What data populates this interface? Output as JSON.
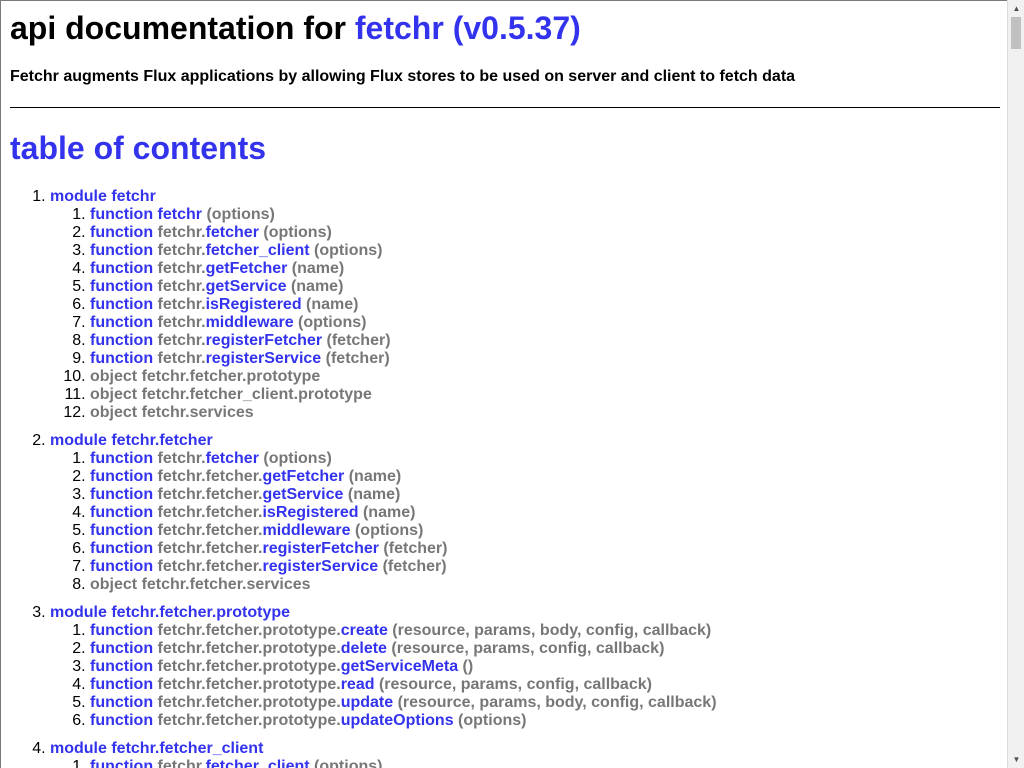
{
  "header": {
    "title_prefix": "api documentation for ",
    "title_link": "fetchr (v0.5.37)",
    "subtitle": "Fetchr augments Flux applications by allowing Flux stores to be used on server and client to fetch data"
  },
  "toc_title": "table of contents",
  "modules": [
    {
      "label": "module fetchr",
      "items": [
        {
          "kind": "function",
          "prefix": "",
          "name": "fetchr",
          "args": " (options)"
        },
        {
          "kind": "function",
          "prefix": "fetchr.",
          "name": "fetcher",
          "args": " (options)"
        },
        {
          "kind": "function",
          "prefix": "fetchr.",
          "name": "fetcher_client",
          "args": " (options)"
        },
        {
          "kind": "function",
          "prefix": "fetchr.",
          "name": "getFetcher",
          "args": " (name)"
        },
        {
          "kind": "function",
          "prefix": "fetchr.",
          "name": "getService",
          "args": " (name)"
        },
        {
          "kind": "function",
          "prefix": "fetchr.",
          "name": "isRegistered",
          "args": " (name)"
        },
        {
          "kind": "function",
          "prefix": "fetchr.",
          "name": "middleware",
          "args": " (options)"
        },
        {
          "kind": "function",
          "prefix": "fetchr.",
          "name": "registerFetcher",
          "args": " (fetcher)"
        },
        {
          "kind": "function",
          "prefix": "fetchr.",
          "name": "registerService",
          "args": " (fetcher)"
        },
        {
          "kind": "object",
          "text": "object fetchr.fetcher.prototype"
        },
        {
          "kind": "object",
          "text": "object fetchr.fetcher_client.prototype"
        },
        {
          "kind": "object",
          "text": "object fetchr.services"
        }
      ]
    },
    {
      "label": "module fetchr.fetcher",
      "items": [
        {
          "kind": "function",
          "prefix": "fetchr.",
          "name": "fetcher",
          "args": " (options)"
        },
        {
          "kind": "function",
          "prefix": "fetchr.fetcher.",
          "name": "getFetcher",
          "args": " (name)"
        },
        {
          "kind": "function",
          "prefix": "fetchr.fetcher.",
          "name": "getService",
          "args": " (name)"
        },
        {
          "kind": "function",
          "prefix": "fetchr.fetcher.",
          "name": "isRegistered",
          "args": " (name)"
        },
        {
          "kind": "function",
          "prefix": "fetchr.fetcher.",
          "name": "middleware",
          "args": " (options)"
        },
        {
          "kind": "function",
          "prefix": "fetchr.fetcher.",
          "name": "registerFetcher",
          "args": " (fetcher)"
        },
        {
          "kind": "function",
          "prefix": "fetchr.fetcher.",
          "name": "registerService",
          "args": " (fetcher)"
        },
        {
          "kind": "object",
          "text": "object fetchr.fetcher.services"
        }
      ]
    },
    {
      "label": "module fetchr.fetcher.prototype",
      "items": [
        {
          "kind": "function",
          "prefix": "fetchr.fetcher.prototype.",
          "name": "create",
          "args": " (resource, params, body, config, callback)"
        },
        {
          "kind": "function",
          "prefix": "fetchr.fetcher.prototype.",
          "name": "delete",
          "args": " (resource, params, config, callback)"
        },
        {
          "kind": "function",
          "prefix": "fetchr.fetcher.prototype.",
          "name": "getServiceMeta",
          "args": " ()"
        },
        {
          "kind": "function",
          "prefix": "fetchr.fetcher.prototype.",
          "name": "read",
          "args": " (resource, params, config, callback)"
        },
        {
          "kind": "function",
          "prefix": "fetchr.fetcher.prototype.",
          "name": "update",
          "args": " (resource, params, body, config, callback)"
        },
        {
          "kind": "function",
          "prefix": "fetchr.fetcher.prototype.",
          "name": "updateOptions",
          "args": " (options)"
        }
      ]
    },
    {
      "label": "module fetchr.fetcher_client",
      "items": [
        {
          "kind": "function",
          "prefix": "fetchr.",
          "name": "fetcher_client",
          "args": " (options)"
        }
      ]
    }
  ],
  "scrollbar": {
    "up_icon": "▲",
    "down_icon": "▼"
  }
}
